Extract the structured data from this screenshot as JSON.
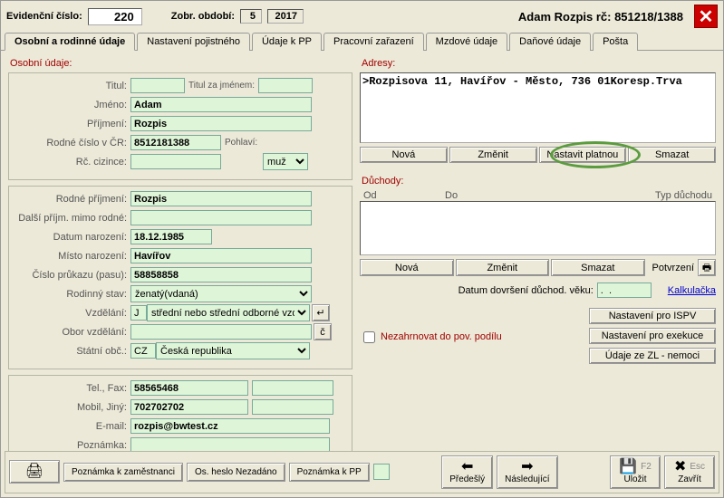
{
  "header": {
    "evid_label": "Evidenční číslo:",
    "evid_value": "220",
    "zobr_label": "Zobr. období:",
    "zobr_month": "5",
    "zobr_year": "2017",
    "person_title": "Adam Rozpis rč: 851218/1388"
  },
  "tabs": [
    "Osobní a rodinné údaje",
    "Nastavení pojistného",
    "Údaje k PP",
    "Pracovní zařazení",
    "Mzdové údaje",
    "Daňové údaje",
    "Pošta"
  ],
  "left": {
    "group_title": "Osobní údaje:",
    "labels": {
      "titul": "Titul:",
      "titul_za": "Titul za jménem:",
      "jmeno": "Jméno:",
      "prijmeni": "Příjmení:",
      "rc": "Rodné číslo v ČR:",
      "pohlavi": "Pohlaví:",
      "rc_cizince": "Rč. cizince:",
      "rodne_prijmeni": "Rodné příjmení:",
      "dalsi_prijmeni": "Další příjm. mimo rodné:",
      "datum_nar": "Datum narození:",
      "misto_nar": "Místo narození:",
      "cislo_pasu": "Číslo průkazu (pasu):",
      "rodinny_stav": "Rodinný stav:",
      "vzdelani": "Vzdělání:",
      "obor": "Obor vzdělání:",
      "statni_obc": "Státní obč.:",
      "tel": "Tel., Fax:",
      "mobil": "Mobil, Jiný:",
      "email": "E-mail:",
      "poznamka": "Poznámka:"
    },
    "values": {
      "titul": "",
      "titul_za": "",
      "jmeno": "Adam",
      "prijmeni": "Rozpis",
      "rc": "8512181388",
      "pohlavi": "muž",
      "rc_cizince": "",
      "rodne_prijmeni": "Rozpis",
      "dalsi_prijmeni": "",
      "datum_nar": "18.12.1985",
      "misto_nar": "Havířov",
      "cislo_pasu": "58858858",
      "rodinny_stav": "ženatý(vdaná)",
      "vzdelani_code": "J",
      "vzdelani_text": "střední nebo střední odborné vzdě",
      "obor": "",
      "statni_obc_code": "CZ",
      "statni_obc_text": "Česká republika",
      "tel": "58565468",
      "fax": "",
      "mobil": "702702702",
      "jiny": "",
      "email": "rozpis@bwtest.cz",
      "poznamka": ""
    }
  },
  "right": {
    "adresy_title": "Adresy:",
    "adresy_line": ">Rozpisova 11, Havířov - Město, 736 01Koresp.Trva",
    "btn_nova": "Nová",
    "btn_zmenit": "Změnit",
    "btn_nastavit_platnou": "Nastavit platnou",
    "btn_smazat": "Smazat",
    "duchody_title": "Důchody:",
    "dh_od": "Od",
    "dh_do": "Do",
    "dh_typ": "Typ důchodu",
    "btn2_nova": "Nová",
    "btn2_zmenit": "Změnit",
    "btn2_smazat": "Smazat",
    "potvrzeni": "Potvrzení",
    "datum_dovrseni_label": "Datum dovršení důchod. věku:",
    "datum_dovrseni_value": ".  .",
    "kalkulacka": "Kalkulačka",
    "checkbox_label": "Nezahrnovat do pov. podílu",
    "side_btns": {
      "ispv": "Nastavení pro ISPV",
      "exekuce": "Nastavení pro exekuce",
      "zl": "Údaje ze ZL - nemoci"
    }
  },
  "bottom": {
    "poznamka_zam": "Poznámka k zaměstnanci",
    "os_heslo": "Os. heslo Nezadáno",
    "poznamka_pp": "Poznámka k PP",
    "predesly": "Předešlý",
    "nasledujici": "Následující",
    "ulozit": "Uložit",
    "ulozit_key": "F2",
    "zavrit": "Zavřít",
    "zavrit_key": "Esc"
  }
}
